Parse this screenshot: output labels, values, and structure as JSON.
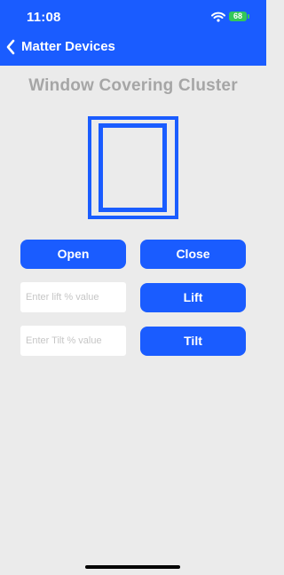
{
  "status": {
    "time": "11:08",
    "battery": "68"
  },
  "nav": {
    "back_title": "Matter Devices"
  },
  "page": {
    "title": "Window Covering Cluster"
  },
  "buttons": {
    "open": "Open",
    "close": "Close",
    "lift": "Lift",
    "tilt": "Tilt"
  },
  "inputs": {
    "lift_placeholder": "Enter lift % value",
    "tilt_placeholder": "Enter Tilt % value"
  },
  "icons": {
    "back": "chevron-left-icon",
    "wifi": "wifi-icon",
    "battery": "battery-icon",
    "window": "window-icon"
  },
  "colors": {
    "accent": "#1a5cff",
    "background": "#ebebeb",
    "title_text": "#a6a6a6",
    "battery": "#34c759"
  }
}
